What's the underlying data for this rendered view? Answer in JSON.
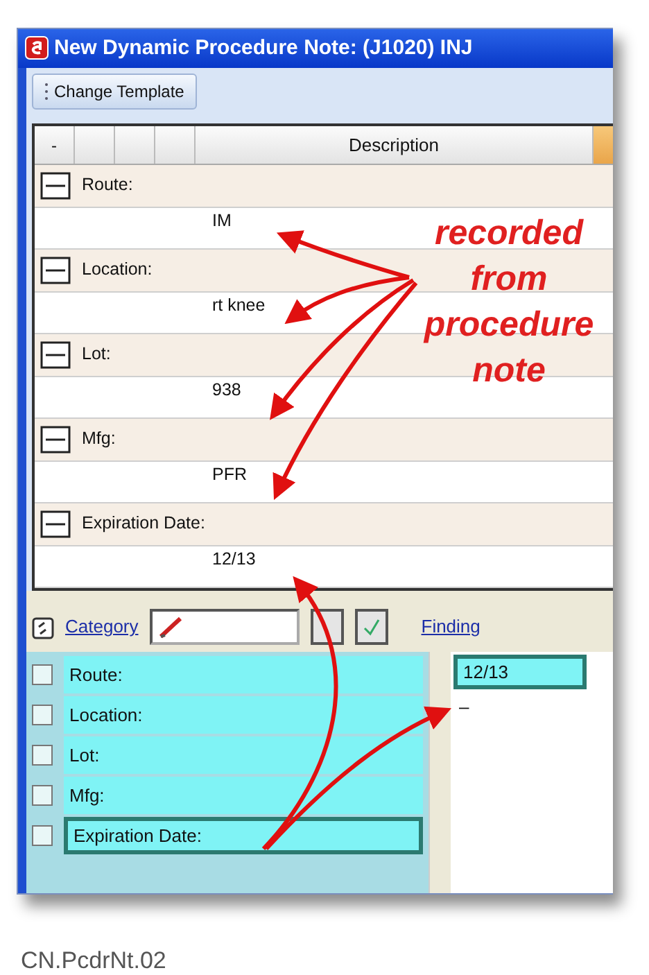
{
  "window": {
    "title": "New Dynamic Procedure Note: (J1020) INJ"
  },
  "toolbar": {
    "button": "Change Template"
  },
  "grid": {
    "columns": [
      "-",
      "Description"
    ],
    "rows": [
      {
        "label": "Route:",
        "value": "IM",
        "expanded": true
      },
      {
        "label": "Location:",
        "value": "rt knee",
        "expanded": true
      },
      {
        "label": "Lot:",
        "value": "938",
        "expanded": true
      },
      {
        "label": "Mfg:",
        "value": "PFR",
        "expanded": true
      },
      {
        "label": "Expiration Date:",
        "value": "12/13",
        "expanded": true
      }
    ]
  },
  "annotation": {
    "lines": [
      "recorded",
      "from",
      "procedure",
      "note"
    ]
  },
  "category_pane": {
    "tab": "Category",
    "finding_tab": "Finding",
    "items": [
      {
        "label": "Route:",
        "checked": false,
        "selected": false
      },
      {
        "label": "Location:",
        "checked": false,
        "selected": false
      },
      {
        "label": "Lot:",
        "checked": false,
        "selected": false
      },
      {
        "label": "Mfg:",
        "checked": false,
        "selected": false
      },
      {
        "label": "Expiration Date:",
        "checked": false,
        "selected": true
      }
    ]
  },
  "finding_pane": {
    "items": [
      {
        "text": "12/13",
        "selected": true
      },
      {
        "text": "–",
        "selected": false
      }
    ]
  },
  "caption": "CN.PcdrNt.02"
}
